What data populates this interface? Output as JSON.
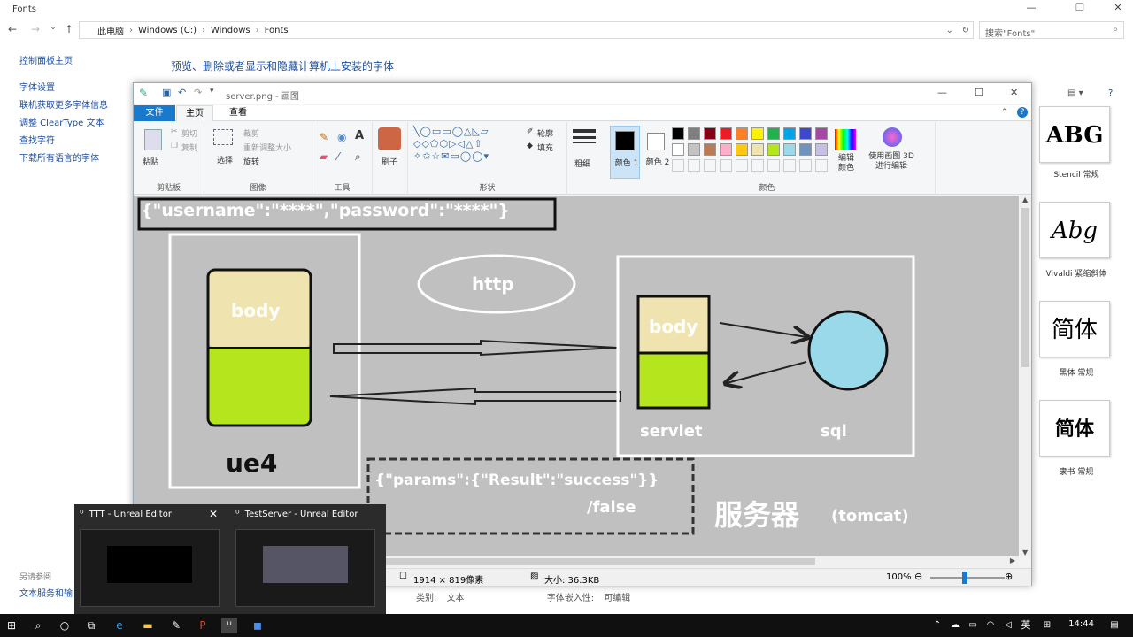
{
  "explorer": {
    "title": "Fonts",
    "breadcrumb": [
      "此电脑",
      "Windows (C:)",
      "Windows",
      "Fonts"
    ],
    "search_placeholder": "搜索\"Fonts\"",
    "heading": "预览、删除或者显示和隐藏计算机上安装的字体",
    "left_nav": [
      "控制面板主页",
      "字体设置",
      "联机获取更多字体信息",
      "调整 ClearType 文本",
      "查找字符",
      "下载所有语言的字体"
    ],
    "see_also": "另请参阅",
    "see_also_link": "文本服务和输",
    "details": {
      "category_label": "类别:",
      "category_value": "文本",
      "embed_label": "字体嵌入性:",
      "embed_value": "可编辑"
    },
    "fonts": [
      {
        "preview": "ABG",
        "caption": "Stencil 常规"
      },
      {
        "preview": "Abg",
        "caption": "Vivaldi 紧缩斜体"
      },
      {
        "preview": "简体",
        "caption": "黑体 常规"
      },
      {
        "preview": "简体",
        "caption": "隶书 常规"
      }
    ]
  },
  "paint": {
    "title": "server.png - 画图",
    "tabs": {
      "file": "文件",
      "home": "主页",
      "view": "查看"
    },
    "ribbon": {
      "clipboard": {
        "label": "剪贴板",
        "paste": "粘贴",
        "cut": "剪切",
        "copy": "复制"
      },
      "image": {
        "label": "图像",
        "select": "选择",
        "crop": "裁剪",
        "resize": "重新调整大小",
        "rotate": "旋转"
      },
      "tools": {
        "label": "工具"
      },
      "brushes": {
        "label": "刷子"
      },
      "shapes": {
        "label": "形状",
        "outline": "轮廓",
        "fill": "填充"
      },
      "size": {
        "label": "粗细"
      },
      "colors": {
        "label": "颜色",
        "color1": "颜色 1",
        "color2": "颜色 2",
        "edit": "编辑颜色",
        "paint3d": "使用画图 3D 进行编辑"
      }
    },
    "palette": [
      "#000000",
      "#7f7f7f",
      "#880015",
      "#ed1c24",
      "#ff7f27",
      "#fff200",
      "#22b14c",
      "#00a2e8",
      "#3f48cc",
      "#a349a4",
      "#ffffff",
      "#c3c3c3",
      "#b97a57",
      "#ffaec9",
      "#ffc90e",
      "#efe4b0",
      "#b5e61d",
      "#99d9ea",
      "#7092be",
      "#c8bfe7"
    ],
    "drawing": {
      "json_request": "{\"username\":\"****\",\"password\":\"****\"}",
      "body_left": "body",
      "ue4": "ue4",
      "http": "http",
      "body_right": "body",
      "servlet": "servlet",
      "sql": "sql",
      "json_response_line1": "{\"params\":{\"Result\":\"success\"}}",
      "json_response_line2": "/false",
      "server_cn": "服务器",
      "server_en": "(tomcat)"
    },
    "status": {
      "dimensions": "1914 × 819像素",
      "size": "大小: 36.3KB",
      "zoom": "100%"
    }
  },
  "taskbar_preview": [
    {
      "title": "TTT - Unreal Editor"
    },
    {
      "title": "TestServer - Unreal Editor"
    }
  ],
  "taskbar": {
    "ime": "英",
    "time": "14:44"
  }
}
